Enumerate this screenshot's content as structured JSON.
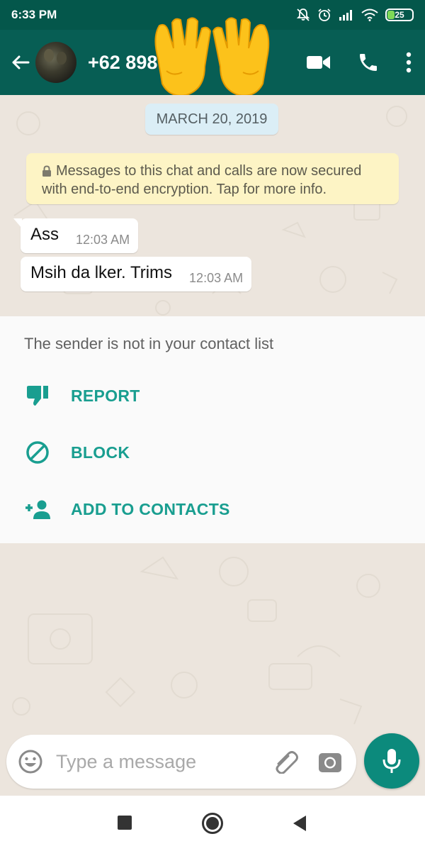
{
  "status_bar": {
    "time": "6:33 PM",
    "battery": "25",
    "icons": [
      "muted-bell-icon",
      "alarm-icon",
      "signal-icon",
      "wifi-icon",
      "battery-icon"
    ]
  },
  "header": {
    "contact_name": "+62 898",
    "icons": [
      "back-arrow-icon",
      "video-call-icon",
      "phone-icon",
      "more-vert-icon"
    ],
    "sticker": "raised-hands-emoji"
  },
  "chat": {
    "date_chip": "MARCH 20, 2019",
    "encryption_notice": "Messages to this chat and calls are now secured with end-to-end encryption. Tap for more info.",
    "messages": [
      {
        "text": "Ass",
        "time": "12:03 AM"
      },
      {
        "text": "Msih da lker. Trims",
        "time": "12:03 AM"
      }
    ]
  },
  "sender_panel": {
    "note": "The sender is not in your contact list",
    "actions": [
      {
        "label": "REPORT",
        "icon": "thumbs-down-icon"
      },
      {
        "label": "BLOCK",
        "icon": "block-icon"
      },
      {
        "label": "ADD TO CONTACTS",
        "icon": "add-person-icon"
      }
    ]
  },
  "composer": {
    "placeholder": "Type a message",
    "icons": [
      "emoji-icon",
      "attach-icon",
      "camera-icon",
      "mic-icon"
    ]
  },
  "colors": {
    "header": "#075e54",
    "status_bar": "#04574b",
    "accent": "#199e90",
    "chat_bg": "#ece5dd",
    "notice_bg": "#fdf4c5",
    "date_bg": "#dbeef6",
    "mic_button": "#0c8a7c"
  }
}
